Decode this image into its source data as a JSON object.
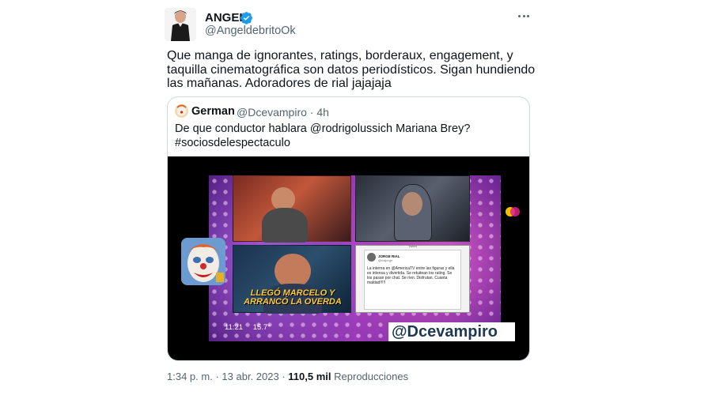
{
  "author": {
    "name": "ANGEL",
    "handle": "@AngeldebritoOk",
    "verified": true,
    "avatar_icon": "avatar-photo-icon"
  },
  "tweet": {
    "text": "Que manga de ignorantes, ratings, borderaux, engagement, y taquilla cinematográfica son datos periodísticos. Sigan hundiendo las mañanas. Adoradores de rial jajajaja",
    "time": "1:34 p. m.",
    "separator": "·",
    "date": "13 abr. 2023",
    "views_count": "110,5 mil",
    "views_label": "Reproducciones"
  },
  "quoted": {
    "name": "German",
    "handle": "@Dcevampiro",
    "separator": "·",
    "age": "4h",
    "text": "De que conductor hablara @rodrigolussich Mariana Brey? #sociosdelespectaculo",
    "media": {
      "caption": "LLEGÓ MARCELO Y ARRANCÓ LA OVERDA",
      "timestamp": "11:21",
      "counter": "15.7°",
      "watermark": "@Dcevampiro",
      "screenshot": {
        "header": "Tweet",
        "name": "JORGE RIAL",
        "handle": "@rialjorge",
        "text": "La interna en @AmericaTV entre las figuras y ella es intensa y divertida. Se retuitean los rating. Se los pasan por chat. Se ríen. Disfrutan. Cuanta maldad!!!!!"
      }
    }
  },
  "colors": {
    "text": "#0f1419",
    "secondary": "#536471",
    "verified": "#1d9bf0",
    "border": "#cfd9de"
  }
}
